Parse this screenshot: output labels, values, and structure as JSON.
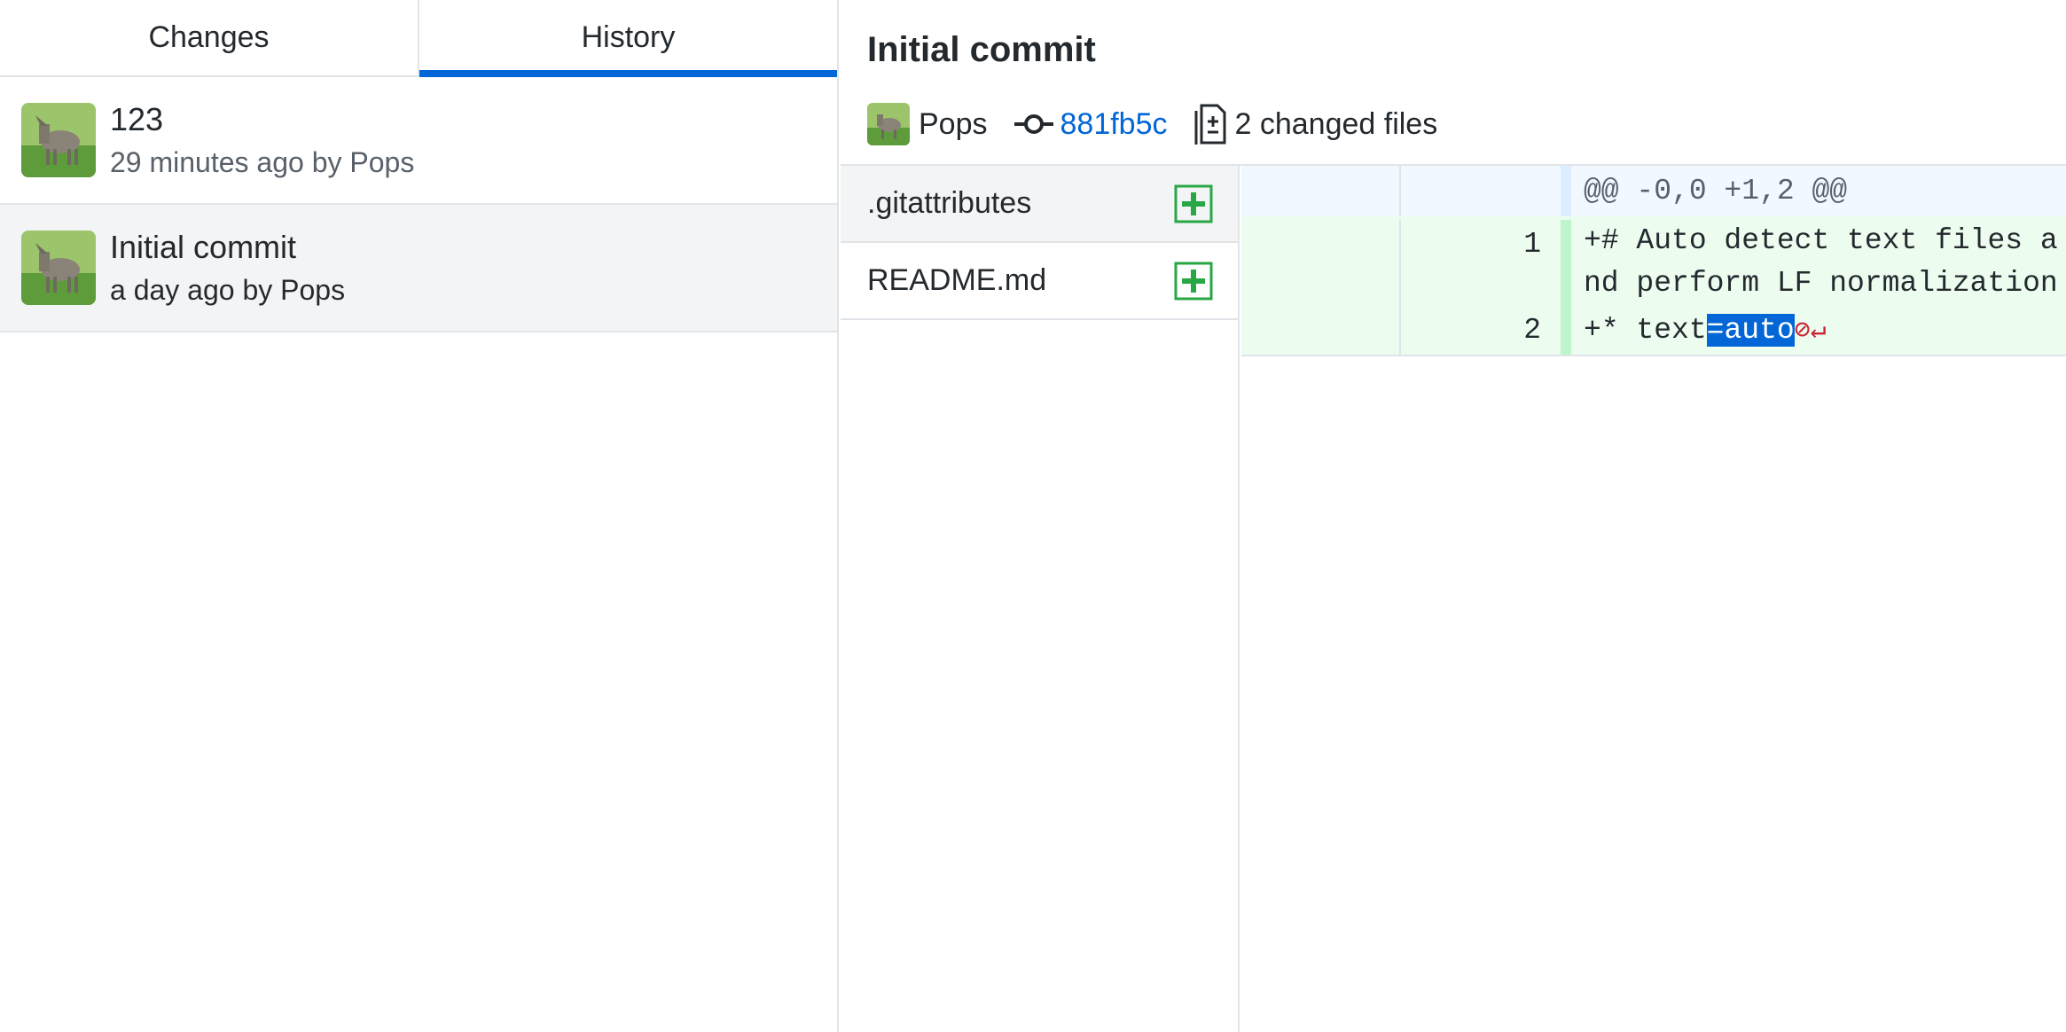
{
  "tabs": [
    {
      "label": "Changes",
      "selected": false
    },
    {
      "label": "History",
      "selected": true
    }
  ],
  "commits": [
    {
      "summary": "123",
      "meta": "29 minutes ago by Pops",
      "selected": false
    },
    {
      "summary": "Initial commit",
      "meta": "a day ago by Pops",
      "selected": true
    }
  ],
  "commit_details": {
    "title": "Initial commit",
    "author": "Pops",
    "sha": "881fb5c",
    "files_changed": "2 changed files"
  },
  "files": [
    {
      "name": ".gitattributes",
      "status": "added",
      "selected": true
    },
    {
      "name": "README.md",
      "status": "added",
      "selected": false
    }
  ],
  "diff": {
    "hunk_header": "@@ -0,0 +1,2 @@",
    "lines": [
      {
        "new_line": "1",
        "prefix": "+",
        "text": "# Auto detect text files and perform LF normalization"
      },
      {
        "new_line": "2",
        "prefix": "+",
        "text_before": "* text",
        "text_selected": "=auto",
        "no_newline_marker": "⊘↵"
      }
    ]
  },
  "colors": {
    "accent": "#0366d6",
    "added_green": "#28a745",
    "removed_red": "#cb2431"
  }
}
